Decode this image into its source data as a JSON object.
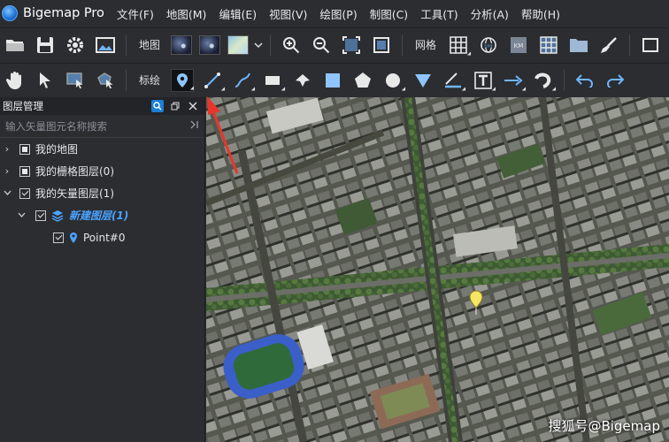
{
  "app": {
    "title": "Bigemap Pro"
  },
  "menu": [
    "文件(F)",
    "地图(M)",
    "编辑(E)",
    "视图(V)",
    "绘图(P)",
    "制图(C)",
    "工具(T)",
    "分析(A)",
    "帮助(H)"
  ],
  "toolbar1": {
    "map_label": "地图",
    "grid_label": "网格"
  },
  "toolbar2": {
    "annotate_label": "标绘"
  },
  "layer_panel": {
    "title": "图层管理",
    "search_placeholder": "输入矢量图元名称搜索",
    "items": [
      {
        "label": "我的地图",
        "expanded": false,
        "checked": "partial"
      },
      {
        "label": "我的栅格图层(0)",
        "expanded": false,
        "checked": "partial"
      },
      {
        "label": "我的矢量图层(1)",
        "expanded": true,
        "checked": true
      },
      {
        "label": "新建图层(1)",
        "expanded": true,
        "checked": true
      },
      {
        "label": "Point#0",
        "checked": true
      }
    ]
  },
  "map": {
    "watermark": "搜狐号@Bigemap",
    "marker_color": "#f5e663"
  },
  "colors": {
    "accent": "#1c7fd6",
    "new_layer": "#4aa3ff",
    "annotation": "#e8362c"
  }
}
